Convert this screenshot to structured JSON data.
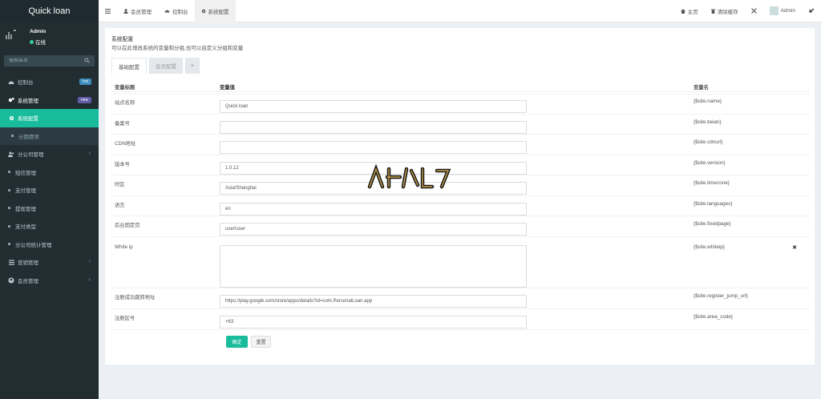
{
  "app": {
    "logo": "Quick loan"
  },
  "user": {
    "name": "Admin",
    "status": "在线"
  },
  "sidebar": {
    "search_placeholder": "搜索菜单",
    "items": [
      {
        "label": "控制台",
        "badge": "hot",
        "badge_color": "#3c8dbc"
      },
      {
        "label": "系统管理",
        "badge": "new",
        "badge_color": "#605ca8"
      },
      {
        "label": "系统配置"
      },
      {
        "label": "分期费率"
      },
      {
        "label": "分公司管理"
      },
      {
        "label": "短信管理"
      },
      {
        "label": "支付管理"
      },
      {
        "label": "提现管理"
      },
      {
        "label": "支付类型"
      },
      {
        "label": "分公司统计管理"
      },
      {
        "label": "营销管理"
      },
      {
        "label": "会员管理"
      }
    ]
  },
  "topbar": {
    "tabs": [
      "会员管理",
      "控制台",
      "系统配置"
    ],
    "home": "主页",
    "clear_cache": "清除缓存",
    "admin": "Admin"
  },
  "page": {
    "title": "系统配置",
    "desc": "可以在此增改系统的变量和分组,也可以自定义分组和变量",
    "tabs": [
      "基础配置",
      "会员配置",
      "+"
    ],
    "headers": [
      "变量标题",
      "变量值",
      "变量名"
    ],
    "rows": [
      {
        "title": "站点名称",
        "value": "Quick loan",
        "name": "{$site.name}"
      },
      {
        "title": "备案号",
        "value": "",
        "name": "{$site.beian}"
      },
      {
        "title": "CDN地址",
        "value": "",
        "name": "{$site.cdnurl}"
      },
      {
        "title": "版本号",
        "value": "1.0.12",
        "name": "{$site.version}"
      },
      {
        "title": "时区",
        "value": "Asia/Shanghai",
        "name": "{$site.timezone}"
      },
      {
        "title": "语言",
        "value": "en",
        "name": "{$site.languages}"
      },
      {
        "title": "后台固定页",
        "value": "user/user",
        "name": "{$site.fixedpage}"
      },
      {
        "title": "White ip",
        "value": "",
        "name": "{$site.whiteip}"
      },
      {
        "title": "注册成功跳转地址",
        "value": "https://play.google.com/store/apps/details?id=com.PersonalLoan.app",
        "name": "{$site.register_jump_url}"
      },
      {
        "title": "注册区号",
        "value": "+63",
        "name": "{$site.area_code}"
      }
    ],
    "submit": "确定",
    "reset": "重置"
  },
  "colors": {
    "accent": "#18bc9c",
    "sidebar": "#222d32"
  }
}
